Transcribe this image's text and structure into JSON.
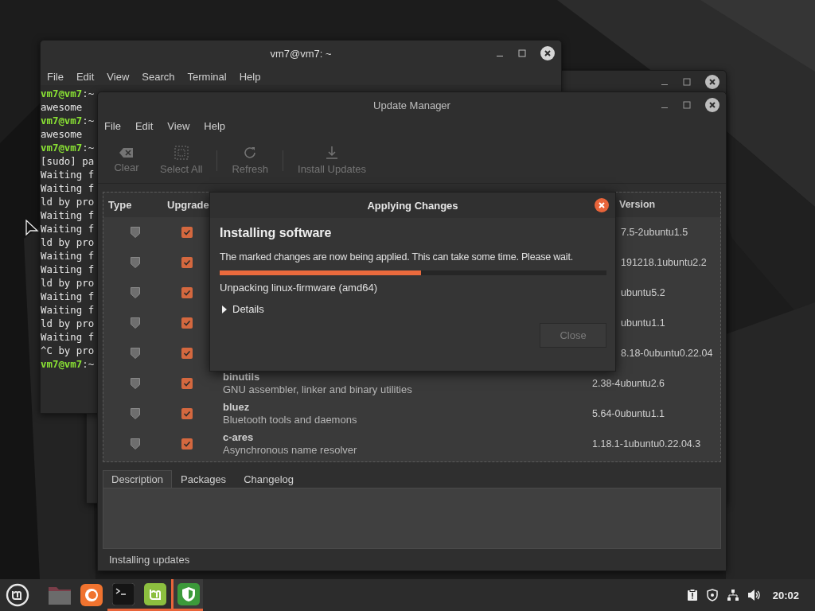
{
  "terminal": {
    "title": "vm7@vm7: ~",
    "menu": [
      "File",
      "Edit",
      "View",
      "Search",
      "Terminal",
      "Help"
    ],
    "lines": [
      {
        "kind": "prompt",
        "host": "vm7@vm7",
        "path": ":~"
      },
      {
        "kind": "output",
        "text": "awesome"
      },
      {
        "kind": "prompt",
        "host": "vm7@vm7",
        "path": ":~"
      },
      {
        "kind": "output",
        "text": "awesome"
      },
      {
        "kind": "prompt",
        "host": "vm7@vm7",
        "path": ":~"
      },
      {
        "kind": "output",
        "text": "[sudo] pa"
      },
      {
        "kind": "output",
        "text": "Waiting f"
      },
      {
        "kind": "output",
        "text": "Waiting f"
      },
      {
        "kind": "output",
        "text": "ld by pro"
      },
      {
        "kind": "output",
        "text": "Waiting f"
      },
      {
        "kind": "output",
        "text": "Waiting f"
      },
      {
        "kind": "output",
        "text": "ld by pro"
      },
      {
        "kind": "output",
        "text": "Waiting f"
      },
      {
        "kind": "output",
        "text": "Waiting f"
      },
      {
        "kind": "output",
        "text": "ld by pro"
      },
      {
        "kind": "output",
        "text": "Waiting f"
      },
      {
        "kind": "output",
        "text": "Waiting f"
      },
      {
        "kind": "output",
        "text": "ld by pro"
      },
      {
        "kind": "output",
        "text": "Waiting f"
      },
      {
        "kind": "output",
        "text": "^C by pro"
      },
      {
        "kind": "prompt",
        "host": "vm7@vm7",
        "path": ":~"
      }
    ]
  },
  "update_manager": {
    "title": "Update Manager",
    "menu": [
      "File",
      "Edit",
      "View",
      "Help"
    ],
    "toolbar": [
      {
        "kind": "button",
        "label": "Clear",
        "disabled": true
      },
      {
        "kind": "button",
        "label": "Select All",
        "disabled": true
      },
      {
        "kind": "separator"
      },
      {
        "kind": "button",
        "label": "Refresh",
        "disabled": true
      },
      {
        "kind": "separator"
      },
      {
        "kind": "button",
        "label": "Install Updates",
        "disabled": true
      }
    ],
    "columns": {
      "type": "Type",
      "upgrade": "Upgrade",
      "version": "Version"
    },
    "rows": [
      {
        "kind": "covered",
        "checked": true,
        "version": "7.5-2ubuntu1.5"
      },
      {
        "kind": "covered",
        "checked": true,
        "version": "191218.1ubuntu2.2"
      },
      {
        "kind": "covered",
        "checked": true,
        "version": "ubuntu5.2"
      },
      {
        "kind": "covered",
        "checked": true,
        "version": "ubuntu1.1"
      },
      {
        "kind": "covered",
        "checked": true,
        "version": "8.18-0ubuntu0.22.04"
      },
      {
        "kind": "full",
        "checked": true,
        "name": "binutils",
        "description": "GNU assembler, linker and binary utilities",
        "version": "2.38-4ubuntu2.6"
      },
      {
        "kind": "full",
        "checked": true,
        "name": "bluez",
        "description": "Bluetooth tools and daemons",
        "version": "5.64-0ubuntu1.1"
      },
      {
        "kind": "full",
        "checked": true,
        "name": "c-ares",
        "description": "Asynchronous name resolver",
        "version": "1.18.1-1ubuntu0.22.04.3"
      }
    ],
    "tabs": [
      {
        "label": "Description",
        "selected": true
      },
      {
        "label": "Packages",
        "selected": false
      },
      {
        "label": "Changelog",
        "selected": false
      }
    ],
    "status": "Installing updates"
  },
  "dialog": {
    "title": "Applying Changes",
    "heading": "Installing software",
    "message": "The marked changes are now being applied. This can take some time. Please wait.",
    "level": 0.52,
    "progress_text": "Unpacking linux-firmware (amd64)",
    "details": {
      "label": "Details",
      "expanded": false
    },
    "close_button": {
      "label": "Close",
      "disabled": true
    }
  },
  "taskbar": {
    "apps": [
      {
        "running": false,
        "selected": false
      },
      {
        "running": false,
        "selected": false
      },
      {
        "running": true,
        "selected": false
      },
      {
        "running": true,
        "selected": false
      },
      {
        "running": true,
        "selected": true
      }
    ],
    "clock": "20:02"
  }
}
